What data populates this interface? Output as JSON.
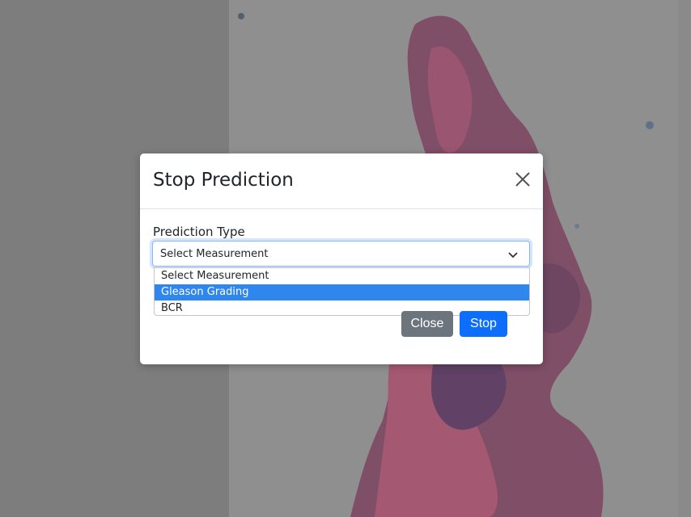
{
  "modal": {
    "title": "Stop Prediction",
    "field_label": "Prediction Type",
    "select": {
      "value": "Select Measurement",
      "options": [
        "Select Measurement",
        "Gleason Grading",
        "BCR"
      ],
      "highlighted": "Gleason Grading"
    },
    "close_label": "Close",
    "stop_label": "Stop"
  },
  "colors": {
    "primary": "#0d6efd",
    "secondary": "#6c757d",
    "highlight": "#2f86ec",
    "tissue_pink": "#b64b6a",
    "tissue_purple": "#5a3460"
  },
  "icons": {
    "close": "close-icon",
    "dropdown": "chevron-down-icon"
  }
}
